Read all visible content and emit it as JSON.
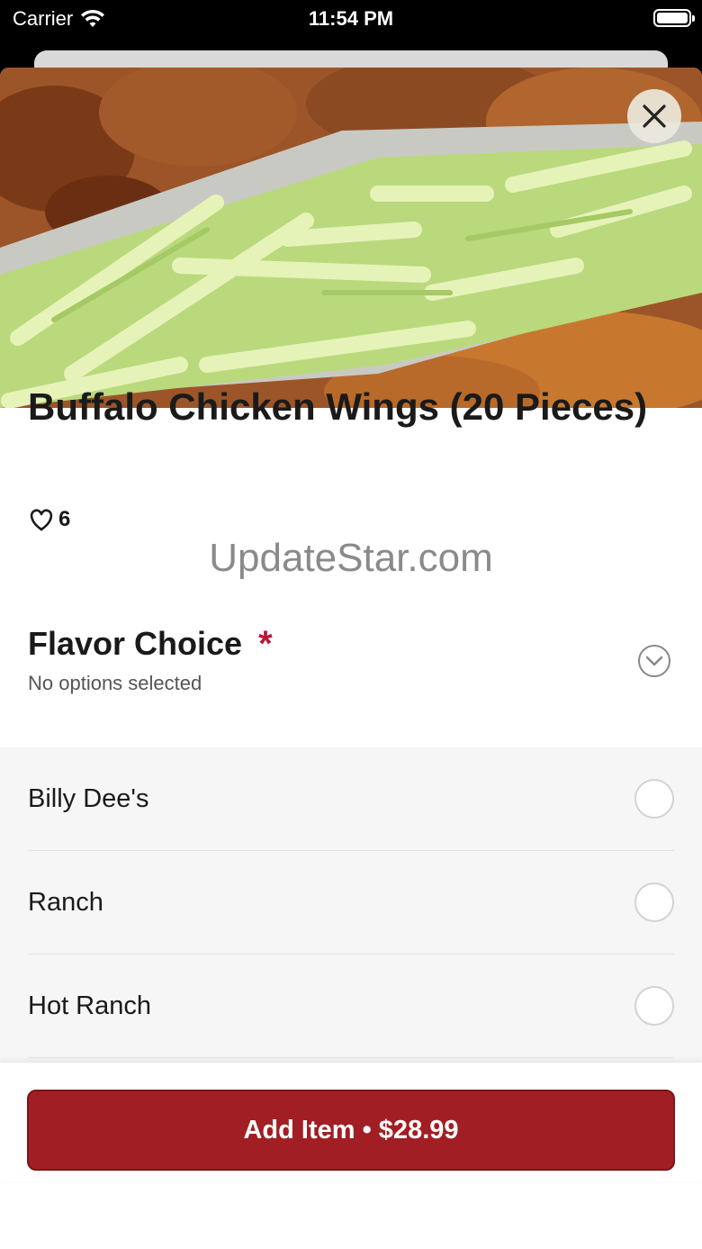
{
  "status_bar": {
    "carrier": "Carrier",
    "time": "11:54 PM"
  },
  "item": {
    "title": "Buffalo Chicken Wings (20 Pieces)",
    "likes": "6",
    "image_description_icon": "wings-photo"
  },
  "watermark": "UpdateStar.com",
  "flavor_section": {
    "title": "Flavor Choice",
    "required_mark": "*",
    "subtitle": "No options selected",
    "options": [
      {
        "label": "Billy Dee's"
      },
      {
        "label": "Ranch"
      },
      {
        "label": "Hot Ranch"
      }
    ]
  },
  "footer": {
    "add_button": "Add Item • $28.99"
  },
  "colors": {
    "accent": "#a11f24",
    "required": "#b8173a"
  }
}
